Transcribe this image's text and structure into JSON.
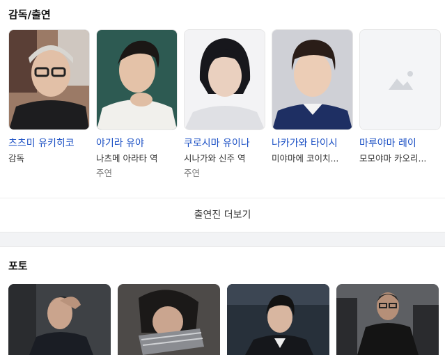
{
  "cast_section": {
    "title": "감독/출연"
  },
  "cast": [
    {
      "name": "츠츠미 유키히코",
      "role": "감독",
      "sub": ""
    },
    {
      "name": "야기라 유야",
      "role": "나츠메 아라타 역",
      "sub": "주연"
    },
    {
      "name": "쿠로시마 유이나",
      "role": "시나가와 신주 역",
      "sub": "주연"
    },
    {
      "name": "나카가와 타이시",
      "role": "미야마에 코이치...",
      "sub": ""
    },
    {
      "name": "마루야마 레이",
      "role": "모모야마 카오리...",
      "sub": ""
    }
  ],
  "more_button": {
    "label": "출연진 더보기"
  },
  "photo_section": {
    "title": "포토"
  },
  "placeholder_icon": "image-placeholder-icon",
  "colors": {
    "link": "#1a4fc4",
    "divider": "#f2f3f5"
  }
}
